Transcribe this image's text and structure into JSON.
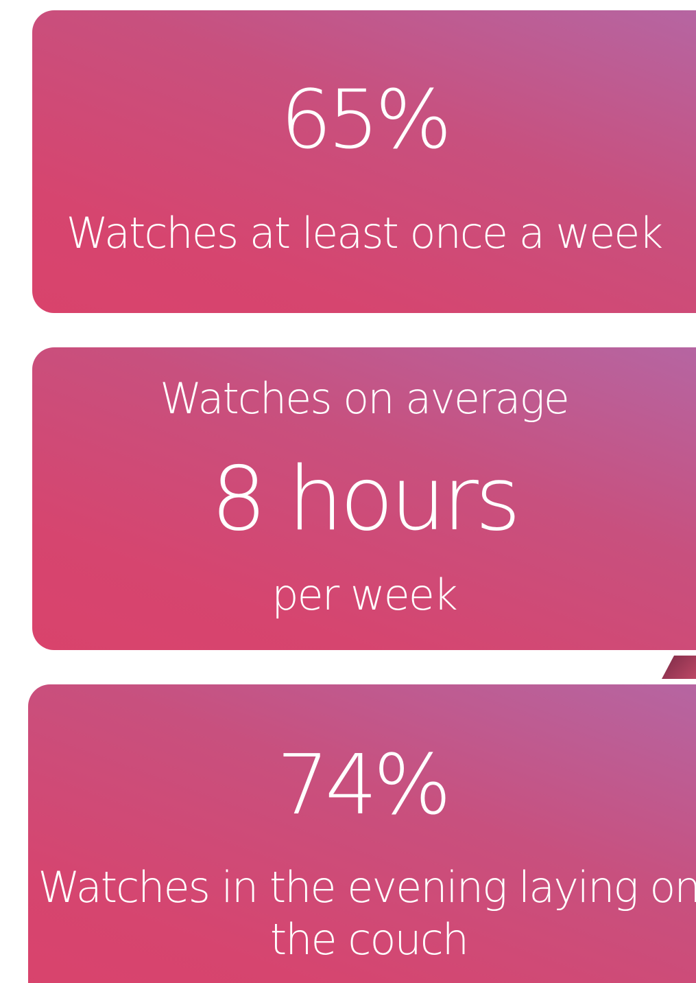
{
  "cards": [
    {
      "value": "65%",
      "caption": "Watches at least once a week"
    },
    {
      "lead": "Watches on average",
      "value": "8 hours",
      "trail": "per week"
    },
    {
      "value": "74%",
      "caption": "Watches in the evening laying on the couch"
    }
  ],
  "colors": {
    "card_gradient_top": "#b566a3",
    "card_gradient_bottom": "#d9436c",
    "text": "#ffffff",
    "background": "#ffffff"
  }
}
